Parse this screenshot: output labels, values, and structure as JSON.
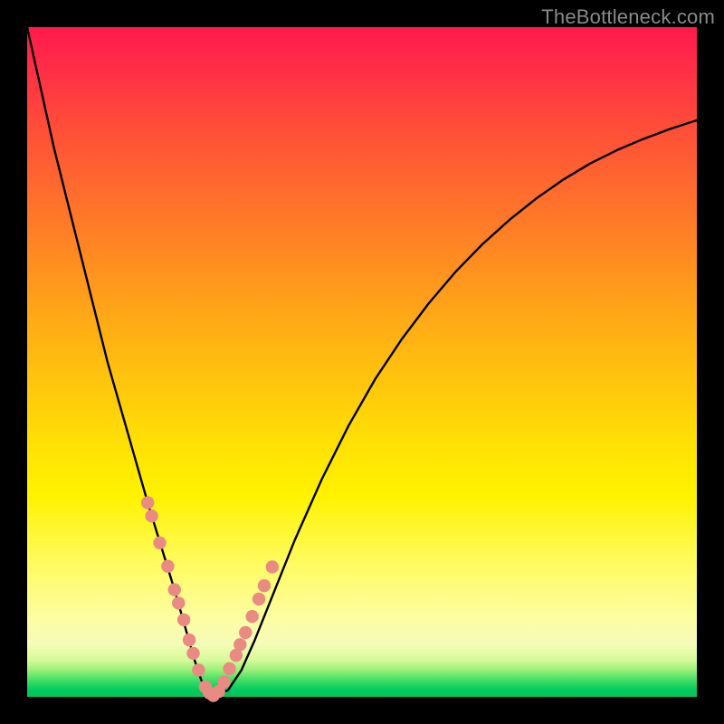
{
  "watermark": {
    "text": "TheBottleneck.com"
  },
  "colors": {
    "curve_stroke": "#000000",
    "marker_fill": "#e98b82",
    "marker_stroke": "#d86a5f",
    "frame_bg": "#000000"
  },
  "chart_data": {
    "type": "line",
    "title": "",
    "xlabel": "",
    "ylabel": "",
    "xlim": [
      0,
      100
    ],
    "ylim": [
      0,
      100
    ],
    "grid": false,
    "legend": false,
    "series": [
      {
        "name": "bottleneck-curve",
        "x": [
          0,
          2,
          4,
          6,
          8,
          10,
          12,
          14,
          16,
          18,
          20,
          22,
          24,
          25,
          26,
          27,
          28,
          30,
          32,
          34,
          36,
          38,
          40,
          44,
          48,
          52,
          56,
          60,
          64,
          68,
          72,
          76,
          80,
          84,
          88,
          92,
          96,
          100
        ],
        "y": [
          100,
          91,
          82,
          74,
          66,
          58,
          50,
          43,
          36,
          29,
          22.5,
          16,
          9,
          5.5,
          2.5,
          1,
          0.2,
          1,
          4,
          8.5,
          13.5,
          18.5,
          23.5,
          32.5,
          40.5,
          47.5,
          53.5,
          58.8,
          63.5,
          67.6,
          71.2,
          74.4,
          77.2,
          79.6,
          81.6,
          83.3,
          84.8,
          86.1
        ]
      }
    ],
    "markers": {
      "name": "highlight-points",
      "x": [
        18.0,
        18.6,
        19.8,
        21.0,
        22.0,
        22.6,
        23.4,
        24.2,
        24.8,
        25.6,
        26.6,
        27.2,
        27.8,
        28.6,
        29.4,
        30.2,
        31.2,
        31.8,
        32.6,
        33.6,
        34.6,
        35.4,
        36.6
      ],
      "y": [
        29.0,
        27.0,
        23.0,
        19.5,
        16.0,
        14.0,
        11.5,
        8.5,
        6.5,
        4.0,
        1.5,
        0.6,
        0.2,
        0.8,
        2.2,
        4.2,
        6.2,
        7.8,
        9.6,
        12.0,
        14.6,
        16.6,
        19.4
      ]
    }
  }
}
